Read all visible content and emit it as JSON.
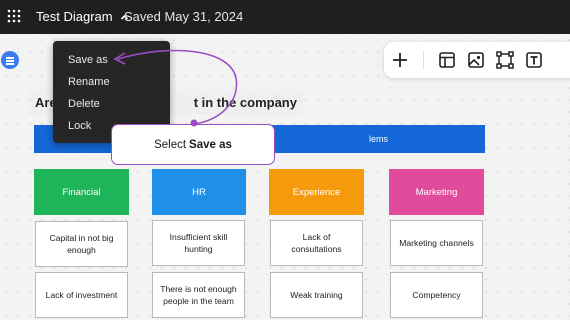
{
  "header": {
    "title": "Test Diagram",
    "saved_status": "Saved May 31, 2024"
  },
  "menu": {
    "items": [
      {
        "label": "Save as"
      },
      {
        "label": "Rename"
      },
      {
        "label": "Delete"
      },
      {
        "label": "Lock"
      }
    ]
  },
  "tooltip": {
    "prefix": "Select",
    "action": "Save as"
  },
  "board": {
    "title_prefix": "Are",
    "title_suffix": "t in the company",
    "banner_text": "lems",
    "categories": [
      {
        "label": "Financial",
        "color": "#1fb45a"
      },
      {
        "label": "HR",
        "color": "#1f8fea"
      },
      {
        "label": "Experience",
        "color": "#f59a0c"
      },
      {
        "label": "Marketing",
        "color": "#e04b9b"
      }
    ],
    "cards": [
      [
        "Capital in not big enough",
        "Lack of investment"
      ],
      [
        "Insufficient skill hunting",
        "There is not enough people in the team"
      ],
      [
        "Lack of consultations",
        "Weak training"
      ],
      [
        "Marketing channels",
        "Competency"
      ]
    ]
  },
  "colors": {
    "accent_purple": "#9b4cc4",
    "banner_blue": "#1467d6",
    "topbar": "#1f1f1f"
  },
  "icons": [
    "apps-grid-icon",
    "chevron-up-icon",
    "menu-icon",
    "plus-icon",
    "layout-icon",
    "image-icon",
    "connect-shapes-icon",
    "text-icon"
  ]
}
